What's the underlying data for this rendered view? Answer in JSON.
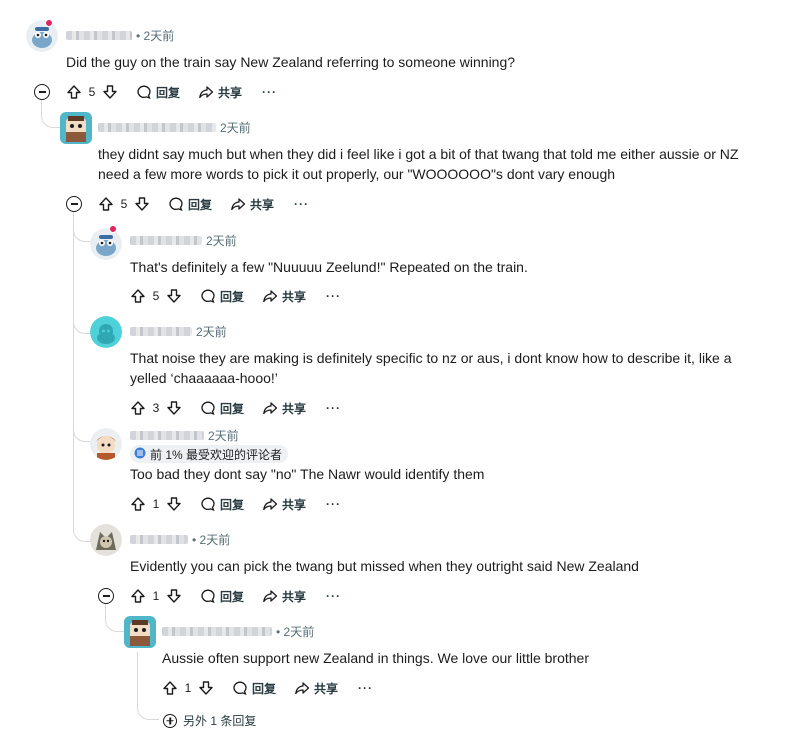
{
  "labels": {
    "reply": "回复",
    "share": "共享",
    "more": "···"
  },
  "comments": [
    {
      "time": "• 2天前",
      "text": "Did the guy on the train say New Zealand referring to someone winning?",
      "votes": "5"
    },
    {
      "time": "2天前",
      "text": "they didnt say much but when they did i feel like i got a bit of that twang that told me either aussie or NZ need a few more words to pick it out properly, our \"WOOOOOO\"s dont vary enough",
      "votes": "5"
    },
    {
      "time": "2天前",
      "text": "That's definitely a few \"Nuuuuu Zeelund!\" Repeated on the train.",
      "votes": "5"
    },
    {
      "time": "2天前",
      "text": "That noise they are making is definitely specific to nz or aus, i dont know how to describe it, like a yelled ‘chaaaaaa-hooo!’",
      "votes": "3"
    },
    {
      "time": "2天前",
      "flair": "前 1% 最受欢迎的评论者",
      "text": "Too bad they dont say \"no\" The Nawr would identify them",
      "votes": "1"
    },
    {
      "time": "• 2天前",
      "text": "Evidently you can pick the twang but missed when they outright said New Zealand",
      "votes": "1"
    },
    {
      "time": "• 2天前",
      "text": "Aussie often support new Zealand in things. We love our little brother",
      "votes": "1"
    }
  ],
  "more_replies": "另外 1 条回复",
  "icons": [
    "upvote-icon",
    "downvote-icon",
    "comment-icon",
    "share-icon",
    "collapse-icon",
    "expand-icon",
    "award-icon"
  ],
  "colors": {
    "text": "#1c1c1c",
    "meta": "#576f76",
    "thread": "#d6d9dc",
    "online": "#e0245e",
    "avatar_teal": "#4fd1d9"
  }
}
